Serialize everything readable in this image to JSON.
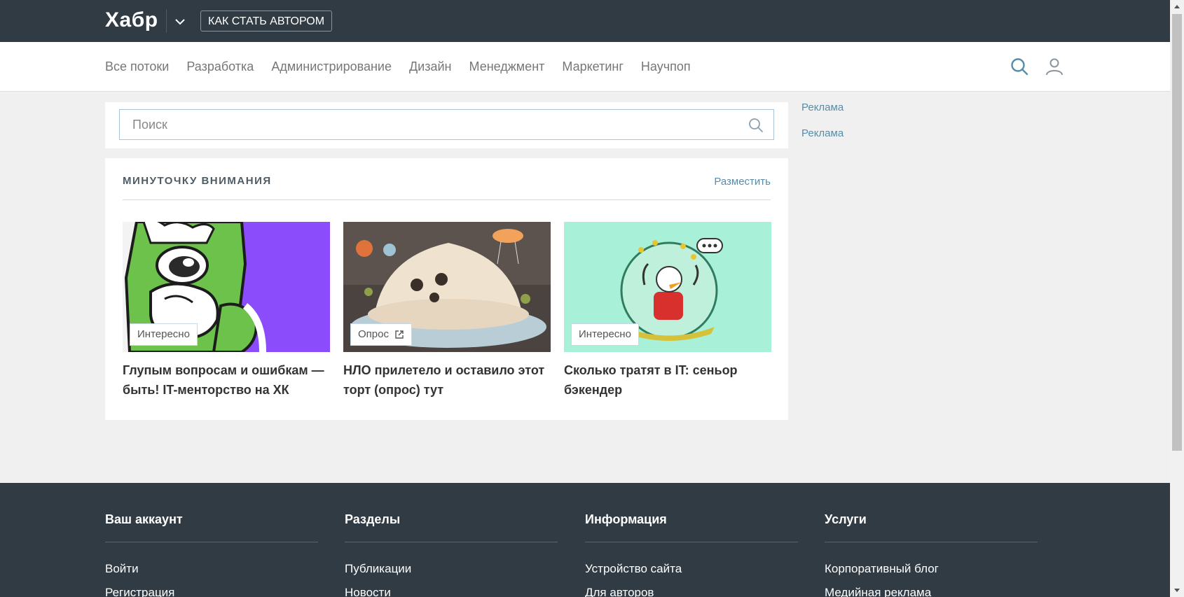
{
  "header": {
    "logo": "Хабр",
    "author_button": "КАК СТАТЬ АВТОРОМ"
  },
  "nav": {
    "items": [
      {
        "label": "Все потоки"
      },
      {
        "label": "Разработка"
      },
      {
        "label": "Администрирование"
      },
      {
        "label": "Дизайн"
      },
      {
        "label": "Менеджмент"
      },
      {
        "label": "Маркетинг"
      },
      {
        "label": "Научпоп"
      }
    ]
  },
  "search": {
    "placeholder": "Поиск"
  },
  "sidebar": {
    "ads": [
      {
        "label": "Реклама"
      },
      {
        "label": "Реклама"
      }
    ]
  },
  "attention": {
    "title": "МИНУТОЧКУ ВНИМАНИЯ",
    "place_link": "Разместить",
    "cards": [
      {
        "badge": "Интересно",
        "title": "Глупым вопросам и ошибкам — быть! IT-менторство на ХК"
      },
      {
        "badge": "Опрос",
        "title": "НЛО прилетело и оставило этот торт (опрос) тут"
      },
      {
        "badge": "Интересно",
        "title": "Сколько тратят в IT: сеньор бэкендер"
      }
    ]
  },
  "footer": {
    "columns": [
      {
        "heading": "Ваш аккаунт",
        "links": [
          "Войти",
          "Регистрация"
        ]
      },
      {
        "heading": "Разделы",
        "links": [
          "Публикации",
          "Новости"
        ]
      },
      {
        "heading": "Информация",
        "links": [
          "Устройство сайта",
          "Для авторов"
        ]
      },
      {
        "heading": "Услуги",
        "links": [
          "Корпоративный блог",
          "Медийная реклама"
        ]
      }
    ]
  },
  "colors": {
    "header_bg": "#303b44",
    "link": "#548eaa",
    "page_bg": "#f0f0f0"
  }
}
